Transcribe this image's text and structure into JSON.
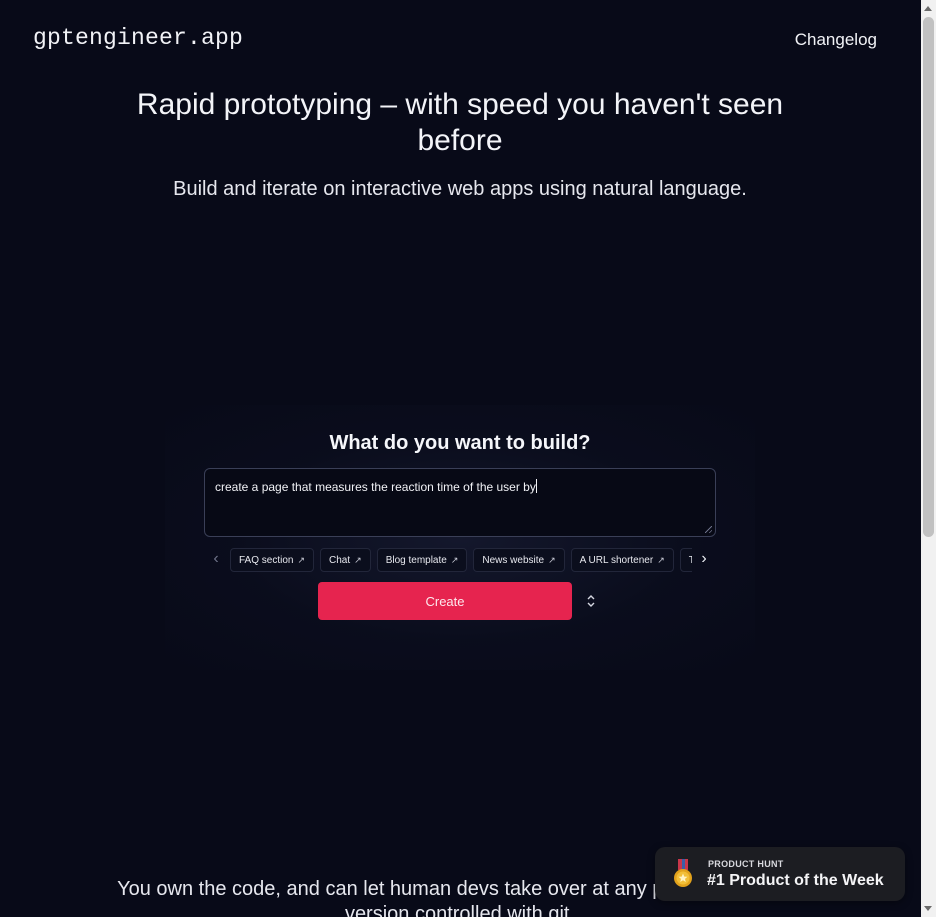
{
  "header": {
    "logo": "gptengineer.app",
    "nav_link": "Changelog"
  },
  "hero": {
    "title": "Rapid prototyping – with speed you haven't seen before",
    "subtitle": "Build and iterate on interactive web apps using natural language."
  },
  "builder": {
    "title": "What do you want to build?",
    "prompt_value": "create a page that measures the reaction time of the user by",
    "suggestions": [
      "FAQ section",
      "Chat",
      "Blog template",
      "News website",
      "A URL shortener",
      "Todo app"
    ],
    "create_label": "Create",
    "icons": {
      "prev": "chevron-left-icon",
      "next": "chevron-right-icon",
      "suggestion": "external-link-arrow-icon",
      "expand": "chevron-up-down-icon"
    }
  },
  "bottom": {
    "text": "You own the code, and can let human devs take over at any point. It's already version controlled with git."
  },
  "badge": {
    "kicker": "PRODUCT HUNT",
    "title": "#1 Product of the Week",
    "icon": "medal-icon"
  },
  "colors": {
    "background": "#080a18",
    "accent": "#e6244f",
    "badge_bg": "#1c1d22"
  }
}
